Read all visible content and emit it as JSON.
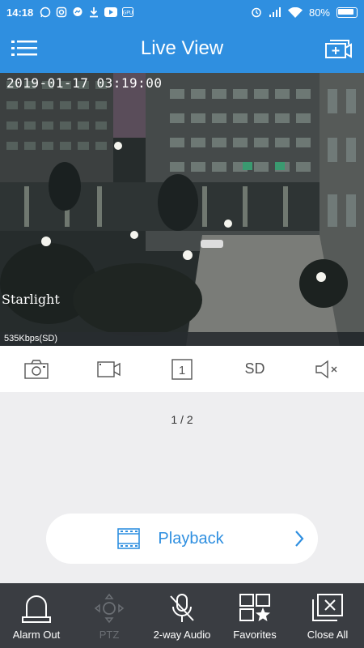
{
  "status_bar": {
    "time": "14:18",
    "battery": "80%",
    "left_icons": [
      "whatsapp-icon",
      "instagram-icon",
      "messenger-icon",
      "download-icon",
      "youtube-icon",
      "app-icon"
    ],
    "right_icons": [
      "alarm-icon",
      "signal-icon",
      "wifi-icon",
      "battery-icon"
    ]
  },
  "header": {
    "title": "Live View",
    "menu_icon": "menu-icon",
    "add_icon": "add-camera-icon",
    "color": "#2f8fe0"
  },
  "video": {
    "timestamp": "2019-01-17  03:19:00",
    "overlay_label": "Starlight",
    "bitrate": "535Kbps(SD)"
  },
  "toolbar": {
    "items": [
      {
        "icon": "camera-icon"
      },
      {
        "icon": "record-icon"
      },
      {
        "icon": "single-view-icon",
        "text": "1"
      },
      {
        "icon": "sd-icon",
        "text": "SD"
      },
      {
        "icon": "mute-icon"
      }
    ]
  },
  "page_indicator": "1 / 2",
  "playback": {
    "label": "Playback",
    "icon": "film-icon",
    "chevron_icon": "chevron-right-icon"
  },
  "bottom_bar": {
    "items": [
      {
        "label": "Alarm Out",
        "icon": "alarm-light-icon",
        "enabled": true
      },
      {
        "label": "PTZ",
        "icon": "ptz-icon",
        "enabled": false
      },
      {
        "label": "2-way Audio",
        "icon": "mic-off-icon",
        "enabled": true
      },
      {
        "label": "Favorites",
        "icon": "favorites-icon",
        "enabled": true
      },
      {
        "label": "Close All",
        "icon": "close-all-icon",
        "enabled": true
      }
    ]
  }
}
